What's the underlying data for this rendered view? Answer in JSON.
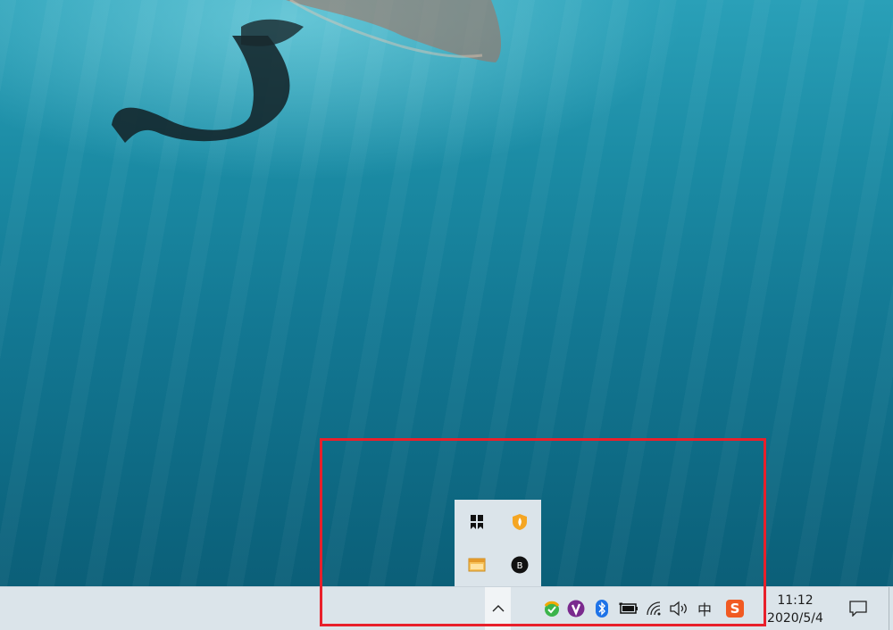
{
  "desktop": {
    "wallpaper": "underwater-swimmer"
  },
  "overflow_tray": {
    "icons": [
      {
        "name": "bookmark-app-icon"
      },
      {
        "name": "shield-security-icon"
      },
      {
        "name": "window-app-icon"
      },
      {
        "name": "b-circle-app-icon"
      }
    ]
  },
  "taskbar": {
    "show_hidden_icons": "chevron-up-icon",
    "tray_icons": [
      {
        "name": "green-check-shield-icon"
      },
      {
        "name": "v-circle-app-icon"
      },
      {
        "name": "bluetooth-icon"
      },
      {
        "name": "battery-icon"
      },
      {
        "name": "wifi-icon"
      },
      {
        "name": "volume-icon"
      }
    ],
    "ime_label": "中",
    "sogou_label": "S",
    "clock": {
      "time": "11:12",
      "date": "2020/5/4"
    }
  },
  "colors": {
    "highlight_border": "#e8202b",
    "taskbar_bg": "#dbe4ea",
    "sogou_orange": "#f15a22"
  }
}
